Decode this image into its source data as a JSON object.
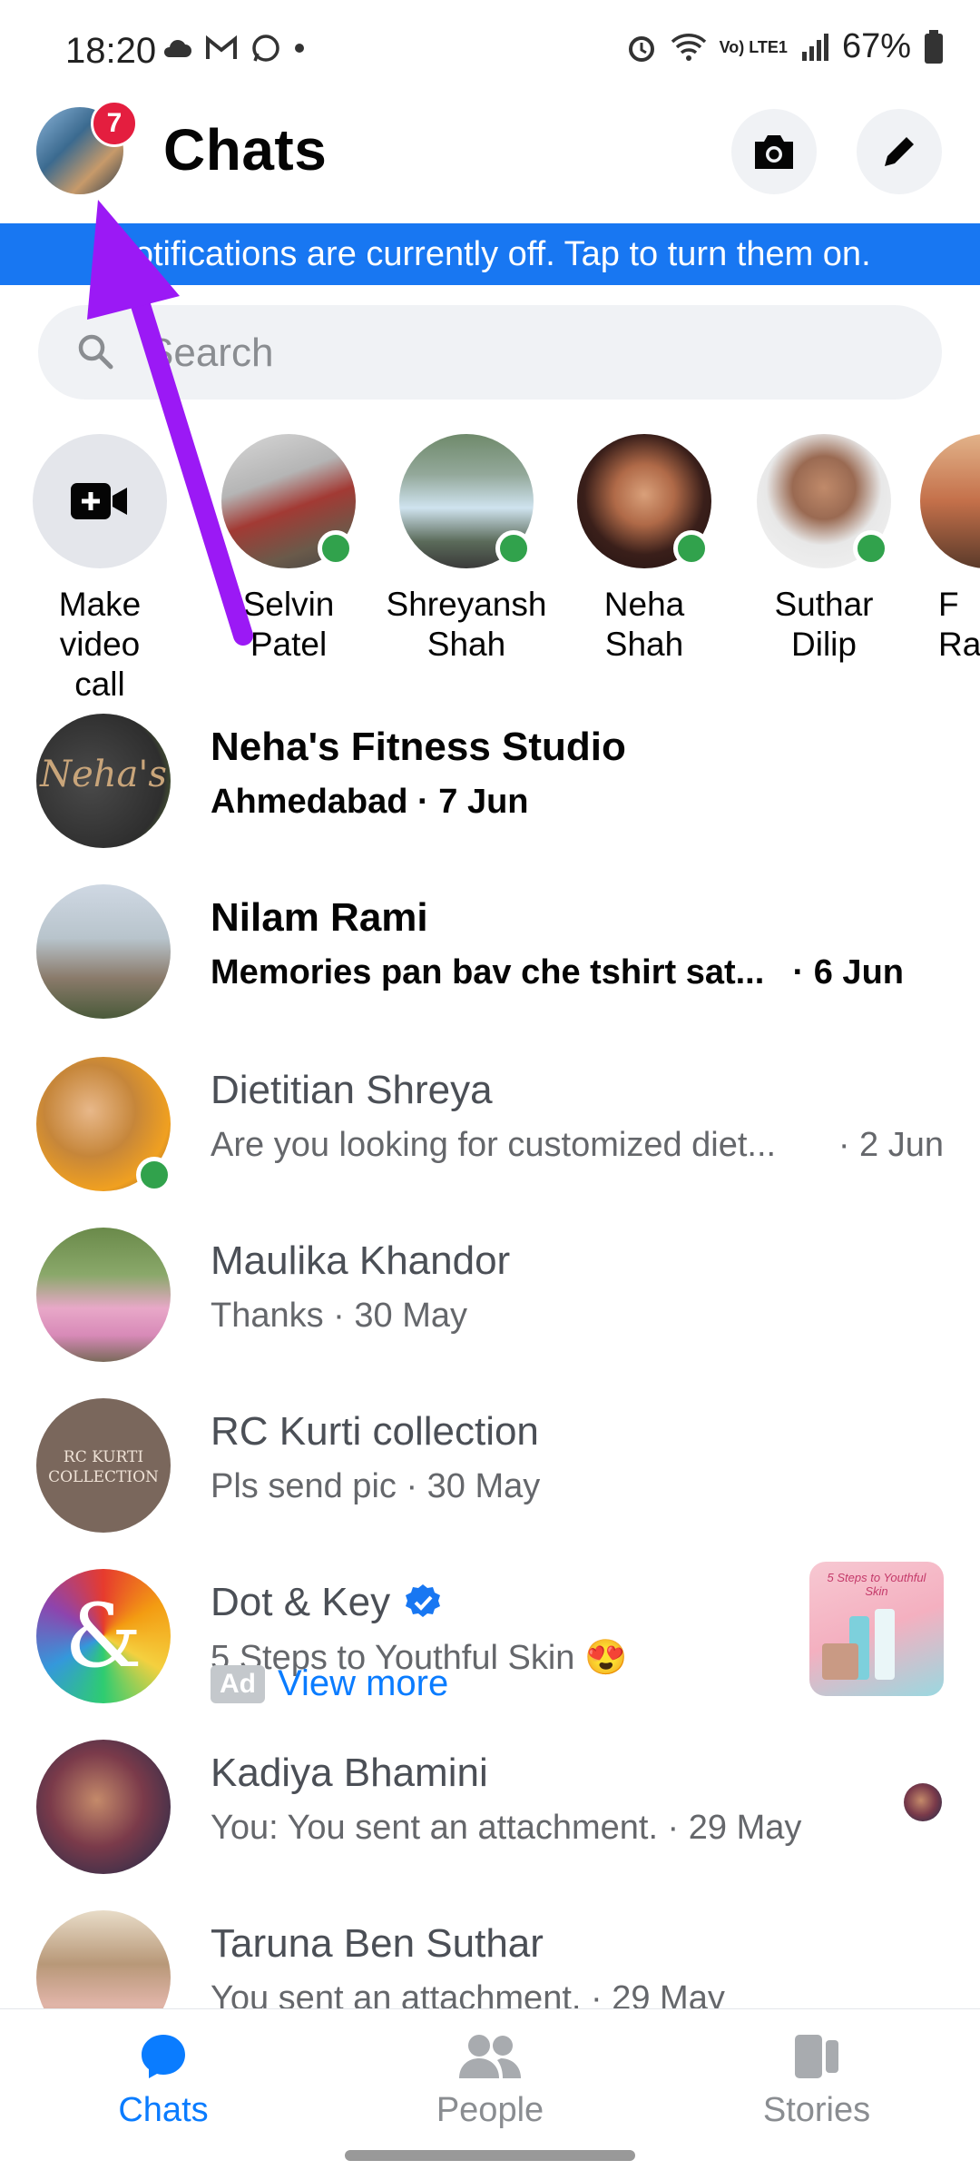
{
  "status_bar": {
    "time": "18:20",
    "battery": "67%",
    "network": "Vo) LTE1"
  },
  "header": {
    "title": "Chats",
    "badge_count": "7"
  },
  "banner": {
    "text": "Notifications are currently off. Tap to turn them on."
  },
  "search": {
    "placeholder": "Search"
  },
  "stories": [
    {
      "name_line1": "Make video",
      "name_line2": "call"
    },
    {
      "name_line1": "Selvin",
      "name_line2": "Patel"
    },
    {
      "name_line1": "Shreyansh",
      "name_line2": "Shah"
    },
    {
      "name_line1": "Neha",
      "name_line2": "Shah"
    },
    {
      "name_line1": "Suthar",
      "name_line2": "Dilip"
    },
    {
      "name_line1": "F",
      "name_line2": "Ra"
    }
  ],
  "chats": [
    {
      "name": "Neha's Fitness Studio",
      "subtitle": "Ahmedabad · 7 Jun",
      "date": "",
      "avatar_text": "Neha's"
    },
    {
      "name": "Nilam Rami",
      "subtitle": "Memories pan bav che tshirt sat...",
      "date": "· 6 Jun"
    },
    {
      "name": "Dietitian Shreya",
      "subtitle": "Are you looking for customized diet...",
      "date": "· 2 Jun"
    },
    {
      "name": "Maulika Khandor",
      "subtitle": "Thanks · 30 May",
      "date": ""
    },
    {
      "name": "RC Kurti collection",
      "subtitle": "Pls send pic · 30 May",
      "date": "",
      "avatar_text_1": "RC KURTI",
      "avatar_text_2": "COLLECTION"
    },
    {
      "name": "Dot & Key",
      "subtitle": "5 Steps to Youthful Skin 😍",
      "date": "",
      "ad_label": "Ad",
      "ad_link": "View more",
      "ad_thumb_text": "5 Steps to Youthful Skin"
    },
    {
      "name": "Kadiya Bhamini",
      "subtitle": "You: You sent an attachment. · 29 May",
      "date": ""
    },
    {
      "name": "Taruna Ben Suthar",
      "subtitle": "You sent an attachment. · 29 May",
      "date": ""
    }
  ],
  "bottom_nav": [
    {
      "label": "Chats",
      "icon": "chat-bubble-icon",
      "active": true
    },
    {
      "label": "People",
      "icon": "people-icon",
      "active": false
    },
    {
      "label": "Stories",
      "icon": "stories-icon",
      "active": false
    }
  ],
  "colors": {
    "accent": "#1877f2",
    "online": "#31a24c",
    "badge": "#e41e3f",
    "arrow": "#9b19f5"
  }
}
